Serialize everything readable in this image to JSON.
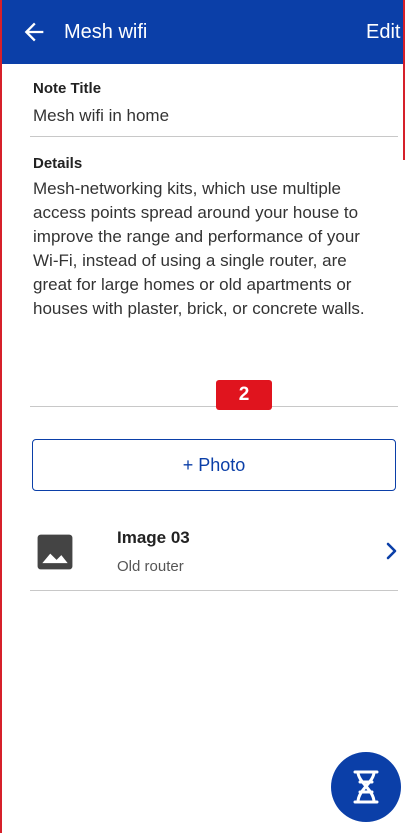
{
  "appbar": {
    "title": "Mesh wifi",
    "edit_label": "Edit",
    "back_icon": "arrow-left-icon",
    "background": "#0b3fa8"
  },
  "note": {
    "title_label": "Note Title",
    "title_value": "Mesh wifi in home",
    "details_label": "Details",
    "details_value": "Mesh-networking kits, which use multiple access points spread around your house to improve the range and performance of your Wi-Fi, instead of using a single router, are great for large homes or old apartments or houses with plaster, brick, or concrete walls."
  },
  "badge": {
    "text": "2",
    "color": "#e0141e"
  },
  "photo_button": {
    "label": "+ Photo"
  },
  "attachments": [
    {
      "title": "Image 03",
      "subtitle": "Old router",
      "icon": "image-icon"
    }
  ],
  "fab": {
    "icon": "dna-icon"
  },
  "colors": {
    "accent": "#0b3fa8",
    "frame": "#d6202a"
  }
}
